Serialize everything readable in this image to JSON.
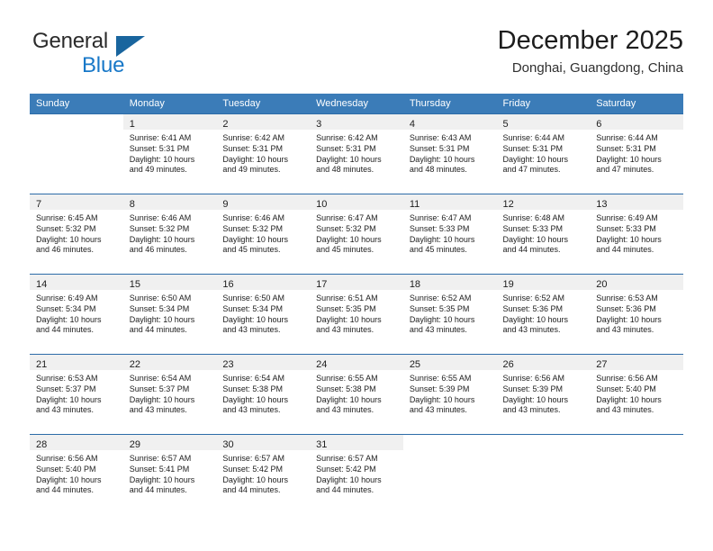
{
  "brand": {
    "name_part1": "General",
    "name_part2": "Blue",
    "triangle_icon": "triangle-logo-icon"
  },
  "header": {
    "month_title": "December 2025",
    "location": "Donghai, Guangdong, China"
  },
  "colors": {
    "header_row_bg": "#3b7cb8",
    "week_separator": "#2d6ca8",
    "daynum_band_bg": "#f0f0f0",
    "brand_blue": "#1878c8",
    "brand_triangle": "#19659e",
    "text": "#1d1d1d"
  },
  "weekday_headers": [
    "Sunday",
    "Monday",
    "Tuesday",
    "Wednesday",
    "Thursday",
    "Friday",
    "Saturday"
  ],
  "weeks": [
    [
      {
        "day": "",
        "sunrise": "",
        "sunset": "",
        "daylight_line1": "",
        "daylight_line2": ""
      },
      {
        "day": "1",
        "sunrise": "Sunrise: 6:41 AM",
        "sunset": "Sunset: 5:31 PM",
        "daylight_line1": "Daylight: 10 hours",
        "daylight_line2": "and 49 minutes."
      },
      {
        "day": "2",
        "sunrise": "Sunrise: 6:42 AM",
        "sunset": "Sunset: 5:31 PM",
        "daylight_line1": "Daylight: 10 hours",
        "daylight_line2": "and 49 minutes."
      },
      {
        "day": "3",
        "sunrise": "Sunrise: 6:42 AM",
        "sunset": "Sunset: 5:31 PM",
        "daylight_line1": "Daylight: 10 hours",
        "daylight_line2": "and 48 minutes."
      },
      {
        "day": "4",
        "sunrise": "Sunrise: 6:43 AM",
        "sunset": "Sunset: 5:31 PM",
        "daylight_line1": "Daylight: 10 hours",
        "daylight_line2": "and 48 minutes."
      },
      {
        "day": "5",
        "sunrise": "Sunrise: 6:44 AM",
        "sunset": "Sunset: 5:31 PM",
        "daylight_line1": "Daylight: 10 hours",
        "daylight_line2": "and 47 minutes."
      },
      {
        "day": "6",
        "sunrise": "Sunrise: 6:44 AM",
        "sunset": "Sunset: 5:31 PM",
        "daylight_line1": "Daylight: 10 hours",
        "daylight_line2": "and 47 minutes."
      }
    ],
    [
      {
        "day": "7",
        "sunrise": "Sunrise: 6:45 AM",
        "sunset": "Sunset: 5:32 PM",
        "daylight_line1": "Daylight: 10 hours",
        "daylight_line2": "and 46 minutes."
      },
      {
        "day": "8",
        "sunrise": "Sunrise: 6:46 AM",
        "sunset": "Sunset: 5:32 PM",
        "daylight_line1": "Daylight: 10 hours",
        "daylight_line2": "and 46 minutes."
      },
      {
        "day": "9",
        "sunrise": "Sunrise: 6:46 AM",
        "sunset": "Sunset: 5:32 PM",
        "daylight_line1": "Daylight: 10 hours",
        "daylight_line2": "and 45 minutes."
      },
      {
        "day": "10",
        "sunrise": "Sunrise: 6:47 AM",
        "sunset": "Sunset: 5:32 PM",
        "daylight_line1": "Daylight: 10 hours",
        "daylight_line2": "and 45 minutes."
      },
      {
        "day": "11",
        "sunrise": "Sunrise: 6:47 AM",
        "sunset": "Sunset: 5:33 PM",
        "daylight_line1": "Daylight: 10 hours",
        "daylight_line2": "and 45 minutes."
      },
      {
        "day": "12",
        "sunrise": "Sunrise: 6:48 AM",
        "sunset": "Sunset: 5:33 PM",
        "daylight_line1": "Daylight: 10 hours",
        "daylight_line2": "and 44 minutes."
      },
      {
        "day": "13",
        "sunrise": "Sunrise: 6:49 AM",
        "sunset": "Sunset: 5:33 PM",
        "daylight_line1": "Daylight: 10 hours",
        "daylight_line2": "and 44 minutes."
      }
    ],
    [
      {
        "day": "14",
        "sunrise": "Sunrise: 6:49 AM",
        "sunset": "Sunset: 5:34 PM",
        "daylight_line1": "Daylight: 10 hours",
        "daylight_line2": "and 44 minutes."
      },
      {
        "day": "15",
        "sunrise": "Sunrise: 6:50 AM",
        "sunset": "Sunset: 5:34 PM",
        "daylight_line1": "Daylight: 10 hours",
        "daylight_line2": "and 44 minutes."
      },
      {
        "day": "16",
        "sunrise": "Sunrise: 6:50 AM",
        "sunset": "Sunset: 5:34 PM",
        "daylight_line1": "Daylight: 10 hours",
        "daylight_line2": "and 43 minutes."
      },
      {
        "day": "17",
        "sunrise": "Sunrise: 6:51 AM",
        "sunset": "Sunset: 5:35 PM",
        "daylight_line1": "Daylight: 10 hours",
        "daylight_line2": "and 43 minutes."
      },
      {
        "day": "18",
        "sunrise": "Sunrise: 6:52 AM",
        "sunset": "Sunset: 5:35 PM",
        "daylight_line1": "Daylight: 10 hours",
        "daylight_line2": "and 43 minutes."
      },
      {
        "day": "19",
        "sunrise": "Sunrise: 6:52 AM",
        "sunset": "Sunset: 5:36 PM",
        "daylight_line1": "Daylight: 10 hours",
        "daylight_line2": "and 43 minutes."
      },
      {
        "day": "20",
        "sunrise": "Sunrise: 6:53 AM",
        "sunset": "Sunset: 5:36 PM",
        "daylight_line1": "Daylight: 10 hours",
        "daylight_line2": "and 43 minutes."
      }
    ],
    [
      {
        "day": "21",
        "sunrise": "Sunrise: 6:53 AM",
        "sunset": "Sunset: 5:37 PM",
        "daylight_line1": "Daylight: 10 hours",
        "daylight_line2": "and 43 minutes."
      },
      {
        "day": "22",
        "sunrise": "Sunrise: 6:54 AM",
        "sunset": "Sunset: 5:37 PM",
        "daylight_line1": "Daylight: 10 hours",
        "daylight_line2": "and 43 minutes."
      },
      {
        "day": "23",
        "sunrise": "Sunrise: 6:54 AM",
        "sunset": "Sunset: 5:38 PM",
        "daylight_line1": "Daylight: 10 hours",
        "daylight_line2": "and 43 minutes."
      },
      {
        "day": "24",
        "sunrise": "Sunrise: 6:55 AM",
        "sunset": "Sunset: 5:38 PM",
        "daylight_line1": "Daylight: 10 hours",
        "daylight_line2": "and 43 minutes."
      },
      {
        "day": "25",
        "sunrise": "Sunrise: 6:55 AM",
        "sunset": "Sunset: 5:39 PM",
        "daylight_line1": "Daylight: 10 hours",
        "daylight_line2": "and 43 minutes."
      },
      {
        "day": "26",
        "sunrise": "Sunrise: 6:56 AM",
        "sunset": "Sunset: 5:39 PM",
        "daylight_line1": "Daylight: 10 hours",
        "daylight_line2": "and 43 minutes."
      },
      {
        "day": "27",
        "sunrise": "Sunrise: 6:56 AM",
        "sunset": "Sunset: 5:40 PM",
        "daylight_line1": "Daylight: 10 hours",
        "daylight_line2": "and 43 minutes."
      }
    ],
    [
      {
        "day": "28",
        "sunrise": "Sunrise: 6:56 AM",
        "sunset": "Sunset: 5:40 PM",
        "daylight_line1": "Daylight: 10 hours",
        "daylight_line2": "and 44 minutes."
      },
      {
        "day": "29",
        "sunrise": "Sunrise: 6:57 AM",
        "sunset": "Sunset: 5:41 PM",
        "daylight_line1": "Daylight: 10 hours",
        "daylight_line2": "and 44 minutes."
      },
      {
        "day": "30",
        "sunrise": "Sunrise: 6:57 AM",
        "sunset": "Sunset: 5:42 PM",
        "daylight_line1": "Daylight: 10 hours",
        "daylight_line2": "and 44 minutes."
      },
      {
        "day": "31",
        "sunrise": "Sunrise: 6:57 AM",
        "sunset": "Sunset: 5:42 PM",
        "daylight_line1": "Daylight: 10 hours",
        "daylight_line2": "and 44 minutes."
      },
      {
        "day": "",
        "sunrise": "",
        "sunset": "",
        "daylight_line1": "",
        "daylight_line2": ""
      },
      {
        "day": "",
        "sunrise": "",
        "sunset": "",
        "daylight_line1": "",
        "daylight_line2": ""
      },
      {
        "day": "",
        "sunrise": "",
        "sunset": "",
        "daylight_line1": "",
        "daylight_line2": ""
      }
    ]
  ]
}
